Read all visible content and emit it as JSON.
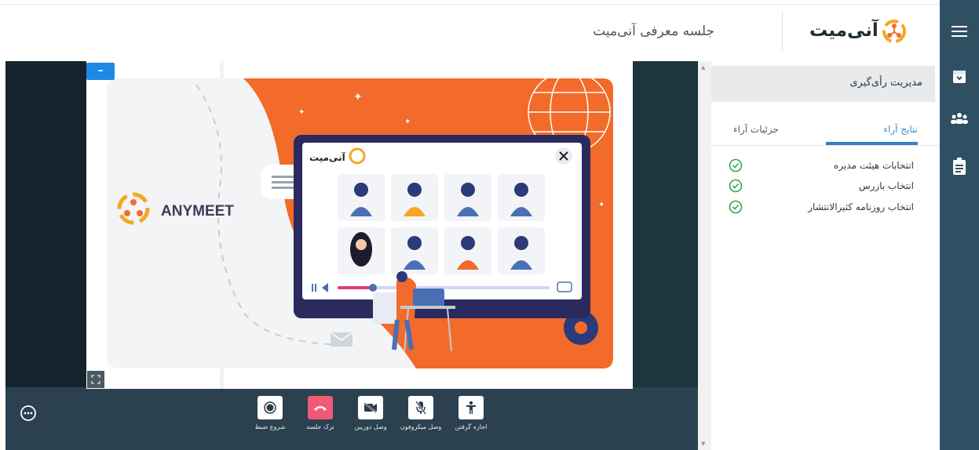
{
  "header": {
    "logo_text": "آنی‌میت",
    "meeting_title": "جلسه معرفی آنی‌میت"
  },
  "rail": {
    "icons": [
      "menu-icon",
      "archive-icon",
      "users-icon",
      "clipboard-icon"
    ]
  },
  "stage": {
    "minimize_label": "–",
    "slide": {
      "brand_name": "ANYMEET",
      "window_logo_text": "آنی‌میت"
    }
  },
  "controls": [
    {
      "name": "record-button",
      "icon": "record-icon",
      "label": "شروع ضبط"
    },
    {
      "name": "leave-button",
      "icon": "phone-hangup-icon",
      "label": "ترک جلسه"
    },
    {
      "name": "camera-button",
      "icon": "camera-off-icon",
      "label": "وصل دوربین"
    },
    {
      "name": "mic-button",
      "icon": "mic-off-icon",
      "label": "وصل میکروفون"
    },
    {
      "name": "request-permission-button",
      "icon": "raise-hand-icon",
      "label": "اجازه گرفتن"
    }
  ],
  "panel": {
    "title": "مدیریت رأی‌گیری",
    "tabs": [
      {
        "label": "نتایج آراء",
        "active": true
      },
      {
        "label": "جزئیات آراء",
        "active": false
      }
    ],
    "votes": [
      {
        "label": "انتخابات هیئت مدیره",
        "status": "done"
      },
      {
        "label": "انتخاب بازرس",
        "status": "done"
      },
      {
        "label": "انتخاب روزنامه کثیرالانتشار",
        "status": "done"
      }
    ]
  },
  "colors": {
    "rail": "#2f4f63",
    "accent_blue": "#2e83c7",
    "orange": "#f26b2a",
    "check_green": "#2fa84f",
    "leave_red": "#ef5b76"
  }
}
